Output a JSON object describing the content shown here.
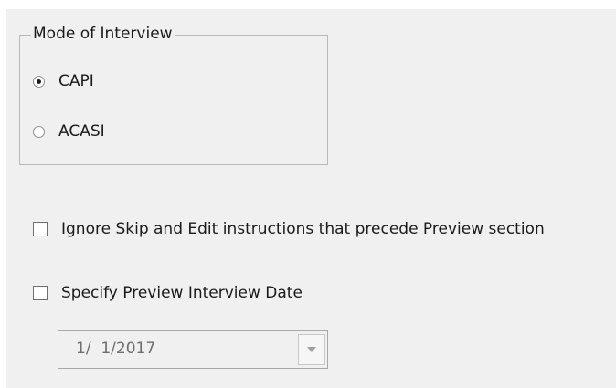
{
  "mode_group": {
    "title": "Mode of Interview",
    "options": [
      {
        "label": "CAPI",
        "selected": true
      },
      {
        "label": "ACASI",
        "selected": false
      }
    ]
  },
  "ignore_skip": {
    "label": "Ignore Skip and Edit instructions that precede Preview section",
    "checked": false
  },
  "specify_date": {
    "label": "Specify Preview Interview Date",
    "checked": false
  },
  "date_picker": {
    "value": "1/  1/2017",
    "enabled": false
  },
  "icons": {
    "dropdown": "chevron-down-icon"
  }
}
